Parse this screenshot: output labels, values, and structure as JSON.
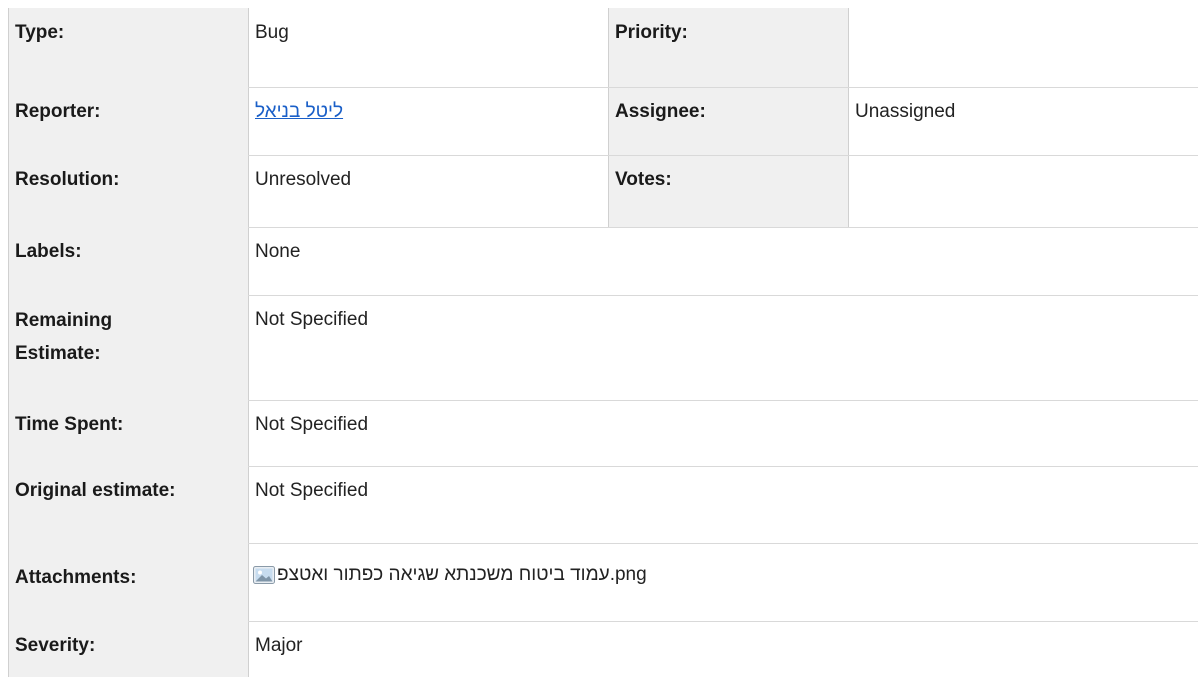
{
  "issue_fields": {
    "type": {
      "label": "Type:",
      "value": "Bug"
    },
    "priority": {
      "label": "Priority:",
      "value": ""
    },
    "reporter": {
      "label": "Reporter:",
      "value": "ליטל בניאל"
    },
    "assignee": {
      "label": "Assignee:",
      "value": "Unassigned"
    },
    "resolution": {
      "label": "Resolution:",
      "value": "Unresolved"
    },
    "votes": {
      "label": "Votes:",
      "value": ""
    },
    "labels": {
      "label": "Labels:",
      "value": "None"
    },
    "remaining_estimate": {
      "label_line1": "Remaining",
      "label_line2": "Estimate:",
      "value": "Not Specified"
    },
    "time_spent": {
      "label": "Time Spent:",
      "value": "Not Specified"
    },
    "original_estimate": {
      "label": "Original estimate:",
      "value": "Not Specified"
    },
    "attachments": {
      "label": "Attachments:",
      "file_name": "עמוד ביטוח משכנתא שגיאה כפתור ואטצפ",
      "file_ext": ".png",
      "icon": "image-file-icon"
    },
    "severity": {
      "label": "Severity:",
      "value": "Major"
    }
  },
  "colors": {
    "label_background": "#f0f0f0",
    "link": "#1a5fc8",
    "border": "#d0d0d0"
  }
}
